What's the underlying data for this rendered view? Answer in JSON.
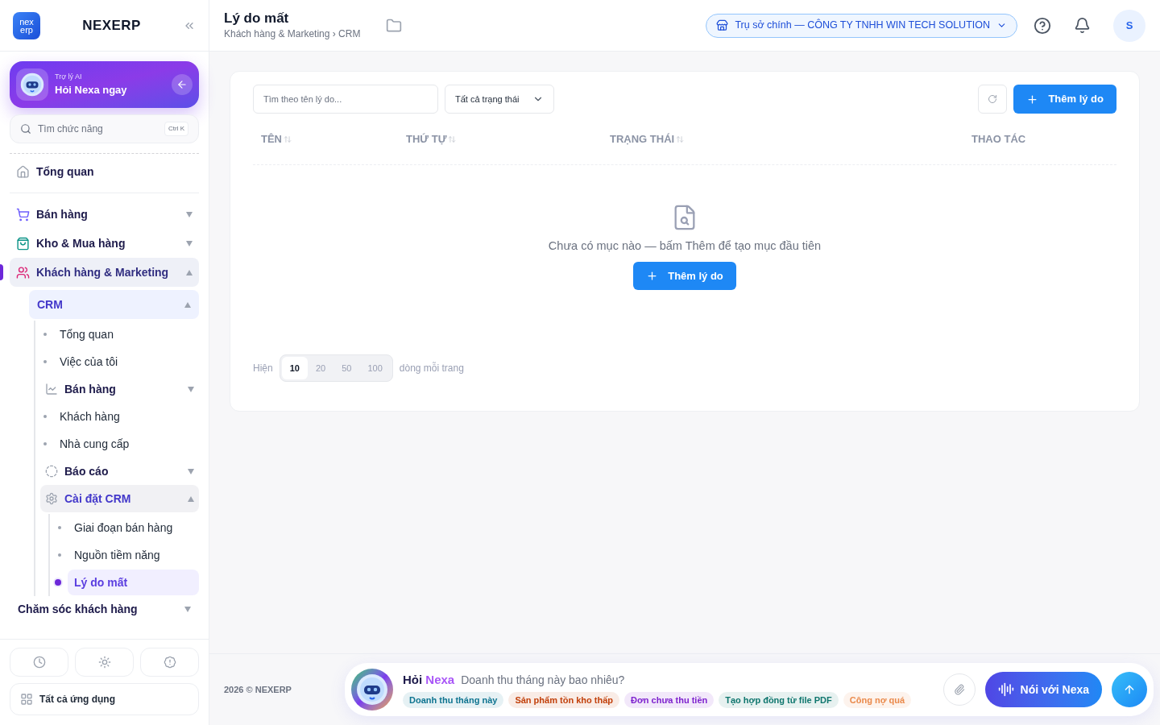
{
  "brand": {
    "name": "NEXERP",
    "logo_top": "nex",
    "logo_bottom": "erp"
  },
  "ai_card": {
    "caption": "Trợ lý AI",
    "title": "Hỏi Nexa ngay"
  },
  "sidebar_search": {
    "placeholder": "Tìm chức năng",
    "shortcut": "Ctrl K"
  },
  "nav_top": [
    {
      "label": "Tổng quan",
      "selected": false
    }
  ],
  "nav": [
    {
      "label": "Bán hàng",
      "kind": "module",
      "expanded": false,
      "selected": false
    },
    {
      "label": "Kho & Mua hàng",
      "kind": "module",
      "expanded": false,
      "selected": false
    },
    {
      "label": "Khách hàng & Marketing",
      "kind": "module",
      "expanded": true,
      "selected": true,
      "children": [
        {
          "label": "CRM",
          "kind": "section",
          "expanded": true,
          "selected": true,
          "children": [
            {
              "label": "Tổng quan",
              "kind": "leaf",
              "selected": false
            },
            {
              "label": "Việc của tôi",
              "kind": "leaf",
              "selected": false
            },
            {
              "label": "Bán hàng",
              "kind": "group",
              "expanded": false,
              "selected": false
            },
            {
              "label": "Khách hàng",
              "kind": "leaf",
              "selected": false
            },
            {
              "label": "Nhà cung cấp",
              "kind": "leaf",
              "selected": false
            },
            {
              "label": "Báo cáo",
              "kind": "group",
              "expanded": false,
              "selected": false
            },
            {
              "label": "Cài đặt CRM",
              "kind": "group",
              "expanded": true,
              "selected": true,
              "children": [
                {
                  "label": "Giai đoạn bán hàng",
                  "kind": "leaf",
                  "selected": false
                },
                {
                  "label": "Nguồn tiềm năng",
                  "kind": "leaf",
                  "selected": false
                },
                {
                  "label": "Lý do mất",
                  "kind": "leaf",
                  "selected": true
                }
              ]
            }
          ]
        }
      ]
    },
    {
      "label": "Chăm sóc khách hàng",
      "kind": "plain",
      "expanded": false,
      "selected": false
    }
  ],
  "sidebar_footer": {
    "all_apps": "Tất cả ứng dụng"
  },
  "header": {
    "title": "Lý do mất",
    "breadcrumb": "Khách hàng & Marketing › CRM",
    "branch": "Trụ sở chính — CÔNG TY TNHH WIN TECH SOLUTION",
    "avatar": "S"
  },
  "toolbar": {
    "search_placeholder": "Tìm theo tên lý do...",
    "status_filter": "Tất cả trạng thái",
    "add_button": "Thêm lý do"
  },
  "table": {
    "columns": [
      {
        "label": "TÊN",
        "sortable": true
      },
      {
        "label": "THỨ TỰ",
        "sortable": true
      },
      {
        "label": "TRẠNG THÁI",
        "sortable": true
      },
      {
        "label": "THAO TÁC",
        "sortable": false
      }
    ],
    "empty_text": "Chưa có mục nào — bấm Thêm để tạo mục đầu tiên",
    "empty_button": "Thêm lý do"
  },
  "pagination": {
    "prefix": "Hiện",
    "suffix": "dòng mỗi trang",
    "sizes": [
      {
        "label": "10",
        "selected": true
      },
      {
        "label": "20",
        "selected": false
      },
      {
        "label": "50",
        "selected": false
      },
      {
        "label": "100",
        "selected": false
      }
    ]
  },
  "footer": {
    "copyright": "2026 © NEXERP"
  },
  "chat": {
    "ask": "Hỏi",
    "name": "Nexa",
    "placeholder": "Doanh thu tháng này bao nhiêu?",
    "voice_button": "Nói với Nexa",
    "chips": [
      {
        "label": "Doanh thu tháng này",
        "color": "#0e7490"
      },
      {
        "label": "Sản phẩm tồn kho thấp",
        "color": "#c2410c"
      },
      {
        "label": "Đơn chưa thu tiền",
        "color": "#7e22ce"
      },
      {
        "label": "Tạo hợp đồng từ file PDF",
        "color": "#0f766e"
      },
      {
        "label": "Công nợ quá",
        "color": "#ea8a4c"
      }
    ]
  }
}
